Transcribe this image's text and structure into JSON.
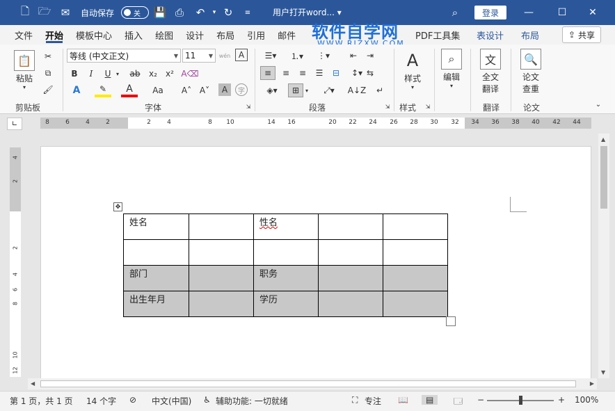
{
  "titlebar": {
    "autosave_label": "自动保存",
    "autosave_state": "关",
    "doc_title": "用户打开word... ▾",
    "login_label": "登录"
  },
  "tabs": [
    "文件",
    "开始",
    "模板中心",
    "插入",
    "绘图",
    "设计",
    "布局",
    "引用",
    "邮件"
  ],
  "tabs_right": [
    "PDF工具集",
    "表设计",
    "布局"
  ],
  "share_label": "共享",
  "watermark": {
    "text": "软件自学网",
    "sub": "WWW.RJZXW.COM"
  },
  "ribbon": {
    "clipboard": {
      "paste": "粘贴",
      "label": "剪贴板"
    },
    "font": {
      "name": "等线 (中文正文)",
      "size": "11",
      "label": "字体",
      "aa_label": "Aa"
    },
    "paragraph": {
      "label": "段落"
    },
    "styles": {
      "btn": "样式",
      "label": "样式"
    },
    "editing": {
      "btn": "编辑"
    },
    "translate": {
      "btn1": "全文",
      "btn2": "翻译",
      "label": "翻译"
    },
    "paper": {
      "btn1": "论文",
      "btn2": "查重",
      "label": "论文"
    }
  },
  "ruler": {
    "ticks": [
      "8",
      "6",
      "4",
      "2",
      "2",
      "4",
      "8",
      "10",
      "14",
      "16",
      "20",
      "22",
      "24",
      "26",
      "28",
      "30",
      "32",
      "34",
      "36",
      "38",
      "40",
      "42",
      "44"
    ]
  },
  "vruler": {
    "ticks": [
      "4",
      "2",
      "2",
      "4",
      "6",
      "8",
      "10",
      "12"
    ]
  },
  "table": {
    "rows": [
      [
        "姓名",
        "",
        "性名",
        "",
        ""
      ],
      [
        "",
        "",
        "",
        "",
        ""
      ],
      [
        "部门",
        "",
        "职务",
        "",
        ""
      ],
      [
        "出生年月",
        "",
        "学历",
        "",
        ""
      ]
    ]
  },
  "status": {
    "page": "第 1 页，共 1 页",
    "words": "14 个字",
    "lang": "中文(中国)",
    "accessibility": "辅助功能: 一切就绪",
    "focus": "专注",
    "zoom": "100%",
    "minus": "−",
    "plus": "+"
  }
}
